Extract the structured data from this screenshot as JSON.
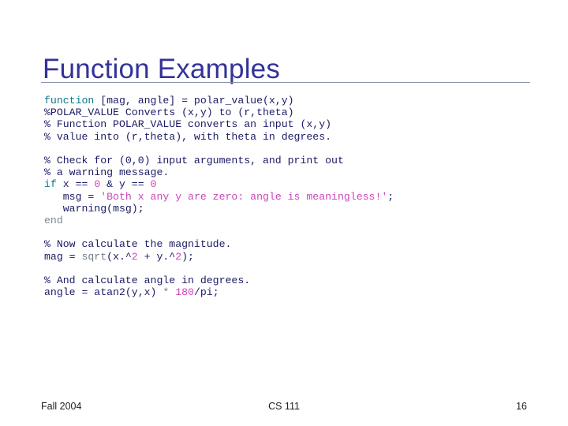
{
  "slide": {
    "title": "Function Examples",
    "title_color": "#333399",
    "rule_color": "#8795ab",
    "background": "#ffffff"
  },
  "code": {
    "default_color": "#1a1a66",
    "keyword_color": "#0b7a8c",
    "builtin_color": "#6f7f85",
    "string_color": "#cc44bb",
    "number_color": "#cc44bb",
    "blocks": [
      {
        "lines": [
          [
            {
              "t": "function",
              "c": "kw"
            },
            {
              "t": " [mag, angle] = polar_value(x,y)",
              "c": "plain"
            }
          ],
          [
            {
              "t": "%POLAR_VALUE Converts (x,y) to (r,theta)",
              "c": "cmt"
            }
          ],
          [
            {
              "t": "% Function POLAR_VALUE converts an input (x,y)",
              "c": "cmt"
            }
          ],
          [
            {
              "t": "% value into (r,theta), with theta in degrees.",
              "c": "cmt"
            }
          ]
        ]
      },
      {
        "lines": [
          [
            {
              "t": "% Check for (0,0) input arguments, and print out",
              "c": "cmt"
            }
          ],
          [
            {
              "t": "% a warning message.",
              "c": "cmt"
            }
          ],
          [
            {
              "t": "if",
              "c": "kw"
            },
            {
              "t": " x == ",
              "c": "plain"
            },
            {
              "t": "0",
              "c": "num"
            },
            {
              "t": " & y == ",
              "c": "plain"
            },
            {
              "t": "0",
              "c": "num"
            }
          ],
          [
            {
              "t": "   msg = ",
              "c": "plain"
            },
            {
              "t": "'Both x any y are zero: angle is meaningless!'",
              "c": "str"
            },
            {
              "t": ";",
              "c": "plain"
            }
          ],
          [
            {
              "t": "   warning(msg);",
              "c": "plain"
            }
          ],
          [
            {
              "t": "end",
              "c": "kwdim"
            }
          ]
        ]
      },
      {
        "lines": [
          [
            {
              "t": "% Now calculate the magnitude.",
              "c": "cmt"
            }
          ],
          [
            {
              "t": "mag = ",
              "c": "plain"
            },
            {
              "t": "sqrt",
              "c": "fn"
            },
            {
              "t": "(x.^",
              "c": "plain"
            },
            {
              "t": "2",
              "c": "num"
            },
            {
              "t": " + y.^",
              "c": "plain"
            },
            {
              "t": "2",
              "c": "num"
            },
            {
              "t": ");",
              "c": "plain"
            }
          ]
        ]
      },
      {
        "lines": [
          [
            {
              "t": "% And calculate angle in degrees.",
              "c": "cmt"
            }
          ],
          [
            {
              "t": "angle = atan2(y,x) ",
              "c": "plain"
            },
            {
              "t": "*",
              "c": "op"
            },
            {
              "t": " ",
              "c": "plain"
            },
            {
              "t": "180",
              "c": "num"
            },
            {
              "t": "/pi;",
              "c": "plain"
            }
          ]
        ]
      }
    ]
  },
  "footer": {
    "left": "Fall 2004",
    "center": "CS 111",
    "right": "16"
  }
}
